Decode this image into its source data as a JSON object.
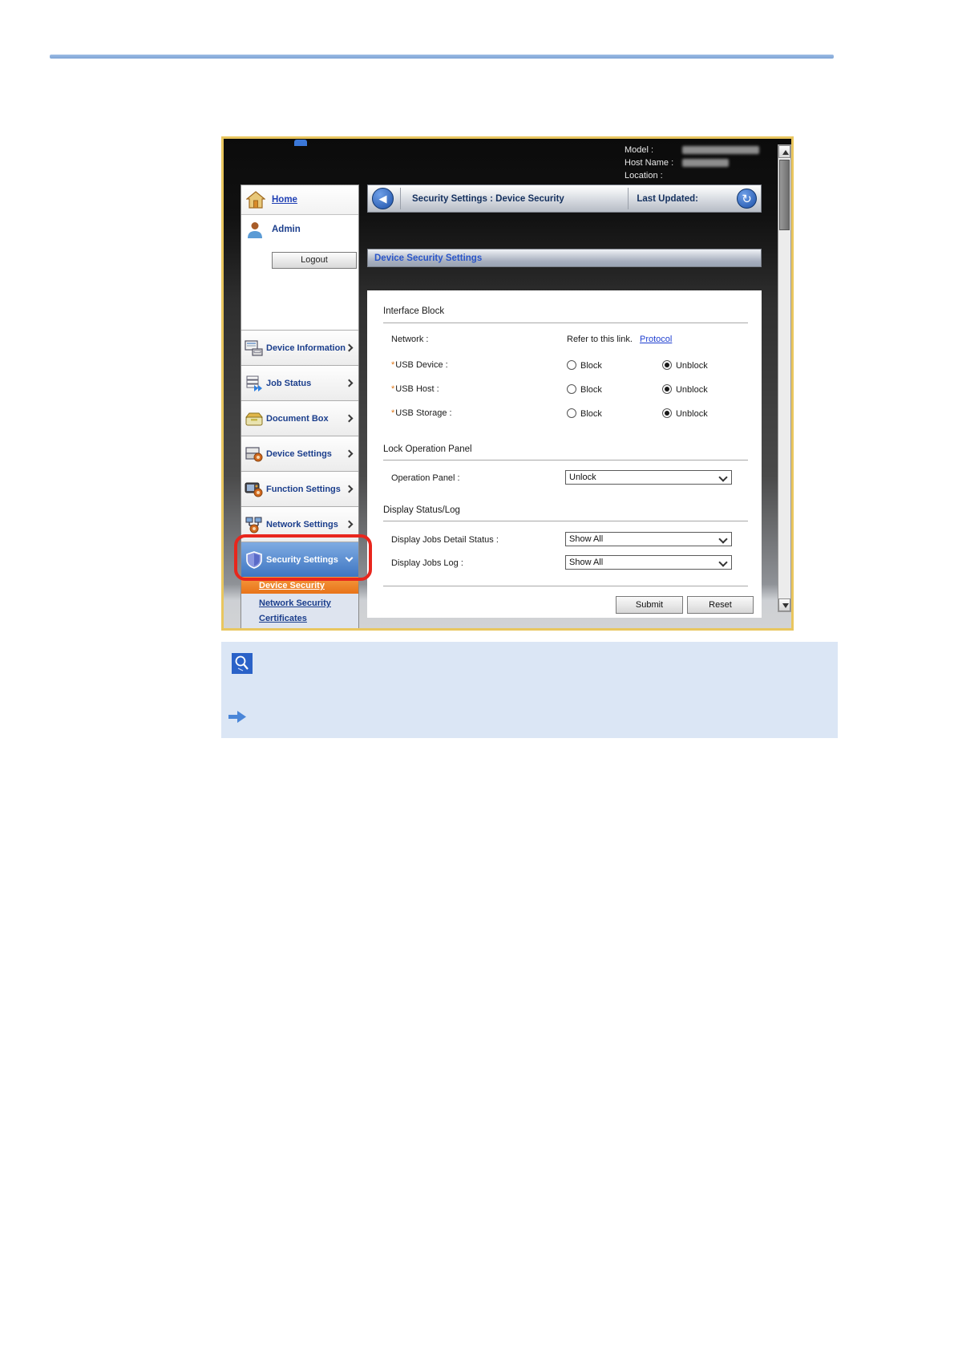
{
  "device_header": {
    "model_label": "Model :",
    "host_label": "Host Name :",
    "location_label": "Location :"
  },
  "toolbar": {
    "title": "Security Settings : Device Security",
    "last_updated_label": "Last Updated:"
  },
  "sidebar": {
    "home_label": "Home",
    "admin_label": "Admin",
    "logout_label": "Logout",
    "menu": [
      {
        "label": "Device Information"
      },
      {
        "label": "Job Status"
      },
      {
        "label": "Document Box"
      },
      {
        "label": "Device Settings"
      },
      {
        "label": "Function Settings"
      },
      {
        "label": "Network Settings"
      },
      {
        "label": "Security Settings"
      }
    ],
    "submenu": [
      {
        "label": "Device Security"
      },
      {
        "label": "Network Security"
      },
      {
        "label": "Certificates"
      }
    ]
  },
  "content": {
    "header": "Device Security Settings",
    "required_mark": "*",
    "interface_block": {
      "title": "Interface Block",
      "network_label": "Network :",
      "network_text": "Refer to this link.",
      "network_link": "Protocol",
      "usb_device_label": "USB Device :",
      "usb_host_label": "USB Host :",
      "usb_storage_label": "USB Storage :",
      "block_label": "Block",
      "unblock_label": "Unblock"
    },
    "lock_panel": {
      "title": "Lock Operation Panel",
      "label": "Operation Panel :",
      "value": "Unlock"
    },
    "display_log": {
      "title": "Display Status/Log",
      "detail_label": "Display Jobs Detail Status :",
      "detail_value": "Show All",
      "log_label": "Display Jobs Log :",
      "log_value": "Show All"
    },
    "submit_label": "Submit",
    "reset_label": "Reset"
  },
  "colors": {
    "accent_gold": "#e9c65f",
    "annotation_red": "#e8261d",
    "security_blue": "#3e76c2",
    "active_orange": "#e8731a",
    "note_blue": "#dbe6f5"
  }
}
